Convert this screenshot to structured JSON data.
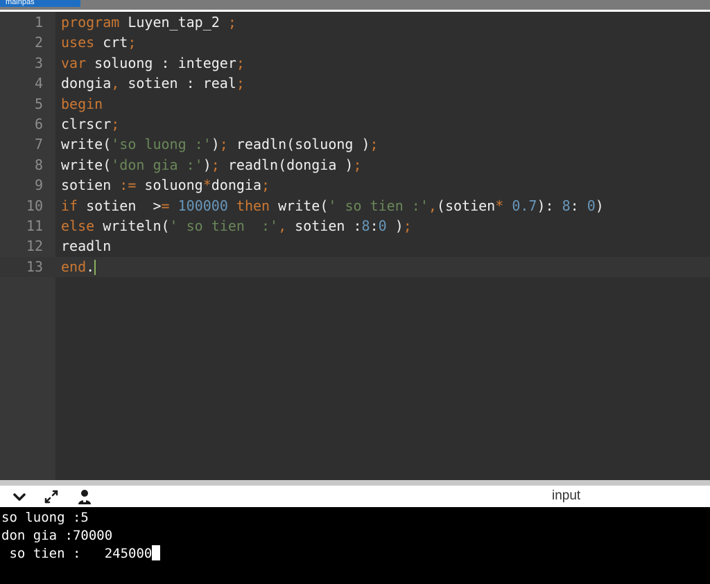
{
  "tab": {
    "label": "mainpas"
  },
  "editor": {
    "lines": [
      {
        "num": "1",
        "tokens": [
          {
            "t": "program",
            "c": "kw"
          },
          {
            "t": " Luyen_tap_2 "
          },
          {
            "t": ";",
            "c": "punc"
          }
        ]
      },
      {
        "num": "2",
        "tokens": [
          {
            "t": "uses",
            "c": "kw"
          },
          {
            "t": " crt"
          },
          {
            "t": ";",
            "c": "punc"
          }
        ]
      },
      {
        "num": "3",
        "tokens": [
          {
            "t": "var",
            "c": "kw"
          },
          {
            "t": " soluong : integer"
          },
          {
            "t": ";",
            "c": "punc"
          }
        ]
      },
      {
        "num": "4",
        "tokens": [
          {
            "t": "dongia"
          },
          {
            "t": ",",
            "c": "punc"
          },
          {
            "t": " sotien : real"
          },
          {
            "t": ";",
            "c": "punc"
          }
        ]
      },
      {
        "num": "5",
        "tokens": [
          {
            "t": "begin",
            "c": "kw"
          }
        ]
      },
      {
        "num": "6",
        "tokens": [
          {
            "t": "clrscr"
          },
          {
            "t": ";",
            "c": "punc"
          }
        ]
      },
      {
        "num": "7",
        "tokens": [
          {
            "t": "write("
          },
          {
            "t": "'so luong :'",
            "c": "str"
          },
          {
            "t": ")"
          },
          {
            "t": ";",
            "c": "punc"
          },
          {
            "t": " readln(soluong )"
          },
          {
            "t": ";",
            "c": "punc"
          }
        ]
      },
      {
        "num": "8",
        "tokens": [
          {
            "t": "write("
          },
          {
            "t": "'don gia :'",
            "c": "str"
          },
          {
            "t": ")"
          },
          {
            "t": ";",
            "c": "punc"
          },
          {
            "t": " readln(dongia )"
          },
          {
            "t": ";",
            "c": "punc"
          }
        ]
      },
      {
        "num": "9",
        "tokens": [
          {
            "t": "sotien "
          },
          {
            "t": ":=",
            "c": "punc"
          },
          {
            "t": " soluong"
          },
          {
            "t": "*",
            "c": "punc"
          },
          {
            "t": "dongia"
          },
          {
            "t": ";",
            "c": "punc"
          }
        ]
      },
      {
        "num": "10",
        "tokens": [
          {
            "t": "if",
            "c": "kw"
          },
          {
            "t": " sotien  >"
          },
          {
            "t": "=",
            "c": "punc"
          },
          {
            "t": " "
          },
          {
            "t": "100000",
            "c": "num"
          },
          {
            "t": " "
          },
          {
            "t": "then",
            "c": "kw"
          },
          {
            "t": " write("
          },
          {
            "t": "' so tien :'",
            "c": "str"
          },
          {
            "t": ",",
            "c": "punc"
          },
          {
            "t": "(sotien"
          },
          {
            "t": "*",
            "c": "punc"
          },
          {
            "t": " "
          },
          {
            "t": "0.7",
            "c": "num"
          },
          {
            "t": "): "
          },
          {
            "t": "8",
            "c": "num"
          },
          {
            "t": ": "
          },
          {
            "t": "0",
            "c": "num"
          },
          {
            "t": ")"
          }
        ]
      },
      {
        "num": "11",
        "tokens": [
          {
            "t": "else",
            "c": "kw"
          },
          {
            "t": " writeln("
          },
          {
            "t": "' so tien  :'",
            "c": "str"
          },
          {
            "t": ",",
            "c": "punc"
          },
          {
            "t": " sotien :"
          },
          {
            "t": "8",
            "c": "num"
          },
          {
            "t": ":"
          },
          {
            "t": "0",
            "c": "num"
          },
          {
            "t": " )"
          },
          {
            "t": ";",
            "c": "punc"
          }
        ]
      },
      {
        "num": "12",
        "tokens": [
          {
            "t": "readln"
          }
        ]
      },
      {
        "num": "13",
        "tokens": [
          {
            "t": "end",
            "c": "kw"
          },
          {
            "t": "."
          }
        ],
        "cursor": true
      }
    ]
  },
  "toolbar": {
    "collapse_icon": "chevron-down-icon",
    "expand_icon": "expand-arrows-icon",
    "user_icon": "user-icon",
    "input_label": "input"
  },
  "console": {
    "lines": [
      "so luong :5",
      "don gia :70000",
      " so tien :   245000"
    ]
  }
}
